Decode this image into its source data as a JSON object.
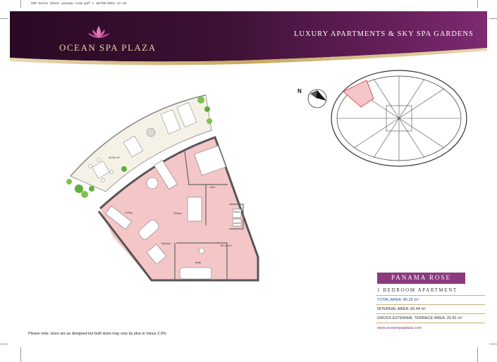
{
  "print_header": "OSP Sales Sheet panama room.pdf   1   18/09/2015   14:10",
  "brand": {
    "name": "OCEAN SPA PLAZA",
    "tagline": "LUXURY APARTMENTS & SKY SPA GARDENS"
  },
  "colors": {
    "purple_dark": "#3a1030",
    "purple": "#8a3b7e",
    "gold": "#c8a85e",
    "pink_room": "#f4c6c8",
    "terrace": "#f6f1e7",
    "total_area_blue": "#1f4e9c"
  },
  "floor_plan": {
    "rooms": {
      "terrace_area": "25.81 m²",
      "bed": "Bed",
      "living": "Living",
      "dining": "Dining",
      "kitchen": "Kitchen",
      "bath": "Bath",
      "store": "Store",
      "linen": "Linen",
      "internal_area": "60.44 m²"
    }
  },
  "compass": {
    "label": "N"
  },
  "apartment": {
    "name": "PANAMA ROSE",
    "type": "1 BEDROOM APARTMENT",
    "total_area": "TOTAL AREA: 86.25 m²",
    "internal_area": "INTERNAL AREA: 60.44 m²",
    "terrace_area": "GROSS EXTERNAL TERRACE AREA: 25.81 m²",
    "website": "www.oceanspaplaza.com"
  },
  "disclaimer": "Please note; sizes are as designed but built sizes may vary by plus or minus 2.5%"
}
